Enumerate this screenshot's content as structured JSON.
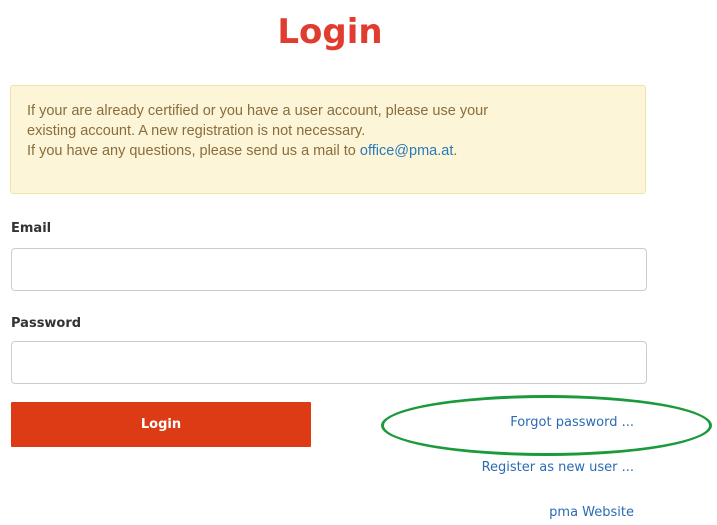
{
  "page": {
    "title": "Login"
  },
  "notice": {
    "line1": "If your are already certified or you have a user account, please use your",
    "line2": "existing account. A new registration is not necessary.",
    "line3_prefix": "If you have any questions, please send us a mail to ",
    "email_link": "office@pma.at",
    "line3_suffix": "."
  },
  "form": {
    "email_label": "Email",
    "email_value": "",
    "password_label": "Password",
    "password_value": "",
    "login_button": "Login"
  },
  "links": {
    "forgot_password": "Forgot password ...",
    "register": "Register as new user ...",
    "website": "pma Website"
  },
  "colors": {
    "title": "#e03c2f",
    "button": "#dd3b16",
    "link": "#2a6cb3",
    "notice_bg": "#fcf5d8",
    "notice_text": "#8a6d3b",
    "highlight_ellipse": "#1a9a3a"
  }
}
